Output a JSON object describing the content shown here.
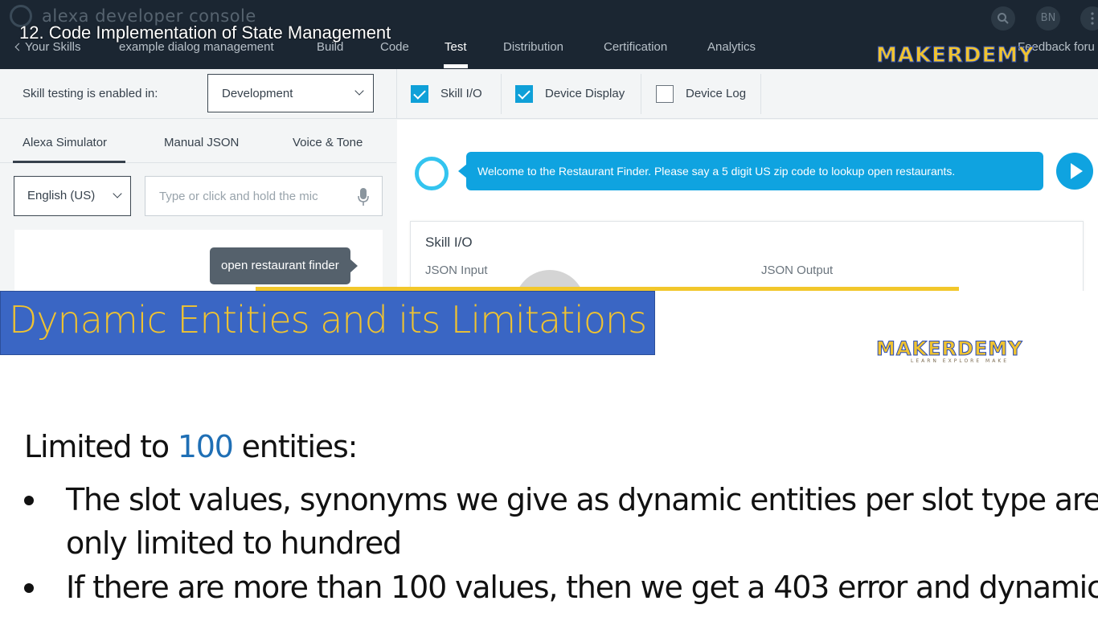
{
  "video_title": "12. Code Implementation of State Management",
  "console": {
    "brand": "alexa developer console",
    "nav": {
      "back": "Your Skills",
      "skill_name": "example dialog management",
      "items": [
        "Build",
        "Code",
        "Test",
        "Distribution",
        "Certification",
        "Analytics"
      ],
      "active": "Test",
      "feedback": "Feedback foru"
    },
    "user_initials": "BN",
    "settings": {
      "label": "Skill testing is enabled in:",
      "stage_value": "Development",
      "toggles": [
        {
          "label": "Skill I/O",
          "checked": true
        },
        {
          "label": "Device Display",
          "checked": true
        },
        {
          "label": "Device Log",
          "checked": false
        }
      ]
    },
    "simulator": {
      "tabs": [
        "Alexa Simulator",
        "Manual JSON",
        "Voice & Tone"
      ],
      "active_tab": "Alexa Simulator",
      "locale": "English (US)",
      "input_placeholder": "Type or click and hold the mic",
      "user_utterance": "open restaurant finder"
    },
    "response": {
      "alexa_text": "Welcome to the Restaurant Finder. Please say a 5 digit US zip code to lookup open restaurants.",
      "card_title": "Skill I/O",
      "json_input": "JSON Input",
      "json_output": "JSON Output"
    }
  },
  "logo": {
    "name": "MAKERDEMY",
    "tagline": "LEARN EXPLORE MAKE"
  },
  "slide": {
    "title": "Dynamic Entities and its Limitations",
    "heading_prefix": "Limited to ",
    "heading_number": "100",
    "heading_suffix": " entities:",
    "bullets": [
      {
        "line1": "The slot values, synonyms we give as dynamic entities per slot type are",
        "line2": "only limited to hundred"
      },
      {
        "line1": "If there are more than 100 values, then we get a 403 error and dynamic",
        "line2": ""
      }
    ]
  },
  "colors": {
    "console_header": "#1b2632",
    "accent_blue": "#0fa3e0",
    "banner_blue": "#3a66c4",
    "title_yellow": "#f0c330",
    "number_blue": "#1f6fb5"
  }
}
